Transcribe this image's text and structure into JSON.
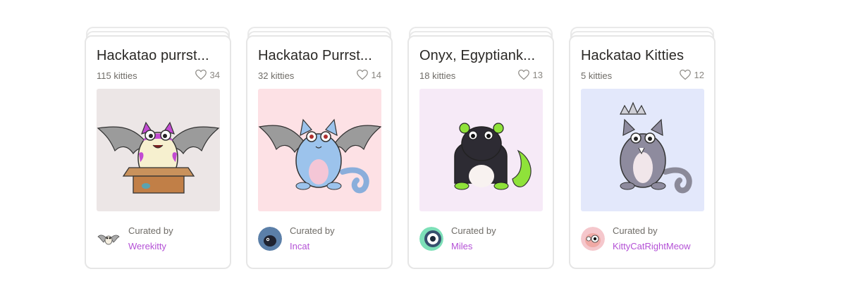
{
  "collections": [
    {
      "title": "Hackatao purrst...",
      "count": "115 kitties",
      "likes": "34",
      "image_bg": "#ece6e6",
      "curated_label": "Curated by",
      "curator": "Werekitty",
      "icons": {
        "like": "heart-outline-icon"
      }
    },
    {
      "title": "Hackatao Purrst...",
      "count": "32 kitties",
      "likes": "14",
      "image_bg": "#fde1e5",
      "curated_label": "Curated by",
      "curator": "Incat",
      "icons": {
        "like": "heart-outline-icon"
      }
    },
    {
      "title": "Onyx, Egyptiank...",
      "count": "18 kitties",
      "likes": "13",
      "image_bg": "#f6eaf7",
      "curated_label": "Curated by",
      "curator": "Miles",
      "icons": {
        "like": "heart-outline-icon"
      }
    },
    {
      "title": "Hackatao Kitties",
      "count": "5 kitties",
      "likes": "12",
      "image_bg": "#e3e8fb",
      "curated_label": "Curated by",
      "curator": "KittyCatRightMeow",
      "icons": {
        "like": "heart-outline-icon"
      }
    }
  ],
  "colors": {
    "curator_link": "#b451d6",
    "text_primary": "#2a2825",
    "text_secondary": "#6f6c67",
    "border": "#e6e6e6"
  }
}
